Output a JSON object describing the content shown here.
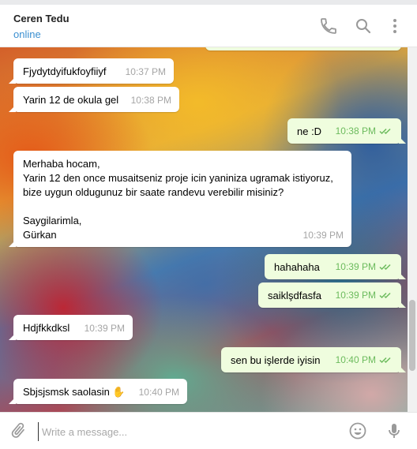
{
  "header": {
    "title": "Ceren Tedu",
    "status": "online",
    "call_icon": "phone-icon",
    "search_icon": "search-icon",
    "menu_icon": "more-vertical-icon"
  },
  "messages": [
    {
      "direction": "in",
      "text": "Fjydytdyifukfoyfiiyf",
      "time": "10:37 PM"
    },
    {
      "direction": "in",
      "text": "Yarin 12 de okula gel",
      "time": "10:38 PM"
    },
    {
      "direction": "out",
      "text": "ne :D",
      "time": "10:38 PM",
      "read": true
    },
    {
      "direction": "in",
      "text": "Merhaba hocam,\nYarin 12 den once musaitseniz proje icin yaniniza ugramak istiyoruz,\nbize uygun oldugunuz bir saate randevu verebilir misiniz?\n\nSaygilarimla,\nGürkan",
      "time": "10:39 PM"
    },
    {
      "direction": "out",
      "text": "hahahaha",
      "time": "10:39 PM",
      "read": true
    },
    {
      "direction": "out",
      "text": "saiklşdfasfa",
      "time": "10:39 PM",
      "read": true
    },
    {
      "direction": "in",
      "text": "Hdjfkkdksl",
      "time": "10:39 PM"
    },
    {
      "direction": "out",
      "text": "sen bu işlerde iyisin",
      "time": "10:40 PM",
      "read": true
    },
    {
      "direction": "in",
      "text": "Sbjsjsmsk saolasin ✋",
      "time": "10:40 PM"
    }
  ],
  "composer": {
    "placeholder": "Write a message...",
    "attach_icon": "paperclip-icon",
    "emoji_icon": "emoji-icon",
    "mic_icon": "microphone-icon"
  },
  "colors": {
    "accent": "#3a8fd0",
    "outgoing_bubble": "#effdde",
    "incoming_bubble": "#ffffff",
    "read_ticks": "#6cbb5d"
  }
}
